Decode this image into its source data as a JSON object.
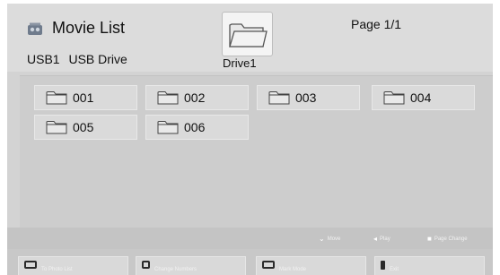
{
  "header": {
    "title": "Movie List",
    "title_icon": "movie-list-icon",
    "source": [
      "USB1",
      "USB Drive"
    ],
    "drive_icon": "folder-icon",
    "drive_label": "Drive1",
    "page_indicator": "Page 1/1"
  },
  "folders": [
    {
      "label": "001",
      "icon": "folder-icon"
    },
    {
      "label": "002",
      "icon": "folder-icon"
    },
    {
      "label": "003",
      "icon": "folder-icon"
    },
    {
      "label": "004",
      "icon": "folder-icon"
    },
    {
      "label": "005",
      "icon": "folder-icon"
    },
    {
      "label": "006",
      "icon": "folder-icon"
    }
  ],
  "hints": [
    {
      "icon": "navigate-icon",
      "label": "Move"
    },
    {
      "icon": "ok-icon",
      "label": "Play"
    },
    {
      "icon": "page-change-icon",
      "label": "Page Change"
    }
  ],
  "color_buttons": [
    {
      "icon": "red-key-icon",
      "label": "To Photo List"
    },
    {
      "icon": "green-key-icon",
      "label": "Change Numbers"
    },
    {
      "icon": "yellow-key-icon",
      "label": "Mark Mode"
    },
    {
      "icon": "blue-key-icon",
      "label": "Exit"
    }
  ]
}
